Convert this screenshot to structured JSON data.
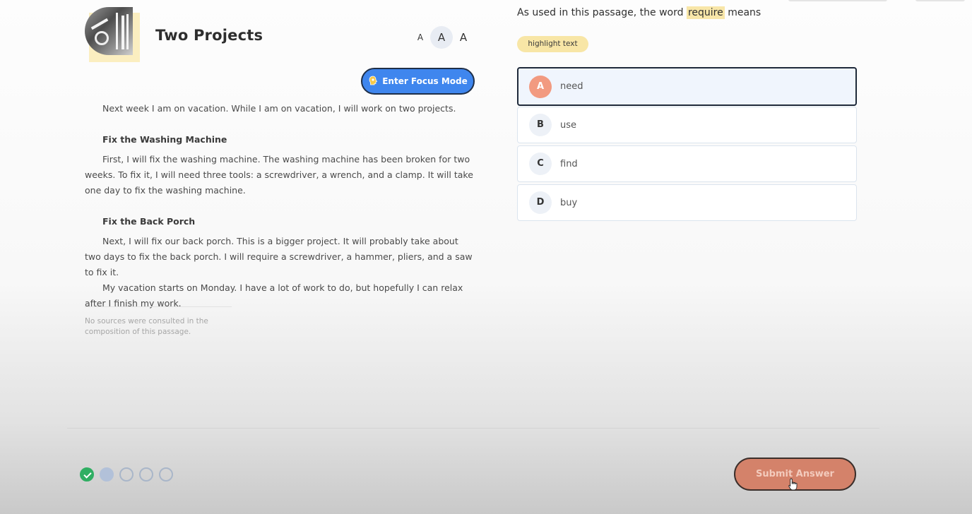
{
  "passage": {
    "title": "Two Projects",
    "font_size_labels": [
      "A",
      "A",
      "A"
    ],
    "focus_button": "Enter Focus Mode",
    "intro": "Next week I am on vacation. While I am on vacation, I will work on two projects.",
    "section1": {
      "heading": "Fix the Washing Machine",
      "body": "First, I will fix the washing machine. The washing machine has been broken for two weeks. To fix it, I will need three tools: a screwdriver, a wrench, and a clamp. It will take one day to fix the washing machine."
    },
    "section2": {
      "heading": "Fix the Back Porch",
      "body1": "Next, I will fix our back porch. This is a bigger project. It will probably take about two days to fix the back porch. I will require a screwdriver, a hammer, pliers, and a saw to fix it.",
      "body2": "My vacation starts on Monday. I have a lot of work to do, but hopefully I can relax after I finish my work."
    },
    "source_note": "No sources were consulted in the composition of this passage."
  },
  "question": {
    "prefix": "As used in this passage, the word ",
    "highlighted": "require",
    "suffix": " means",
    "highlight_button": "highlight text",
    "choices": [
      {
        "letter": "A",
        "text": "need",
        "selected": true
      },
      {
        "letter": "B",
        "text": "use",
        "selected": false
      },
      {
        "letter": "C",
        "text": "find",
        "selected": false
      },
      {
        "letter": "D",
        "text": "buy",
        "selected": false
      }
    ]
  },
  "footer": {
    "progress": [
      "complete",
      "current",
      "pending",
      "pending",
      "pending"
    ],
    "submit_label": "Submit Answer"
  },
  "colors": {
    "focus_button": "#3f86ee",
    "selected_letter": "#f29a80",
    "highlight": "#f8e6a8",
    "submit": "#d4826a",
    "progress_complete": "#2fae62"
  },
  "icons": {
    "focus_button": "head-lightbulb-icon",
    "progress_complete": "checkmark-icon",
    "cursor": "hand-pointer-icon"
  }
}
